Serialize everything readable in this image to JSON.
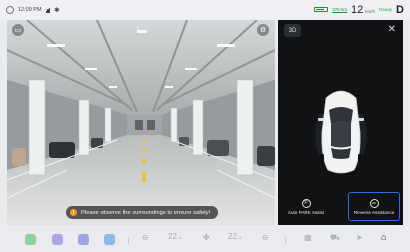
{
  "status_bar": {
    "time": "12:09 PM",
    "range": "376 km",
    "speed": "12",
    "speed_unit": "km/h",
    "drive_mode": "Ready",
    "gear": "D",
    "battery_level": 0.75,
    "icons": [
      "avatar-icon",
      "signal-icon",
      "bluetooth-icon",
      "battery-icon"
    ]
  },
  "camera": {
    "warning_text": "Please observe the surroundings to ensure safety!",
    "warning_icon": "!",
    "top_left_icon": "camera-switch-icon",
    "top_center_icon": "car-front-icon",
    "top_right_icon": "settings-icon",
    "floor_color": "#d3d6d5",
    "ceiling_color": "#c9cccc"
  },
  "view3d": {
    "label": "3D",
    "close_label": "✕",
    "auto_park_label": "Auto PARK Assist",
    "reverse_label": "Reverse Assistance",
    "accent": "#2f6fe0"
  },
  "dock": {
    "apps": [
      {
        "name": "green-app-icon",
        "color": "#8fd39a"
      },
      {
        "name": "purple-app-icon",
        "color": "#a9a6e6"
      },
      {
        "name": "indigo-app-icon",
        "color": "#9fa3e8"
      },
      {
        "name": "blue-app-icon",
        "color": "#8fb7ea"
      }
    ],
    "left_temp": "22.",
    "left_temp_unit": "5",
    "right_temp": "22.",
    "right_temp_unit": "5"
  }
}
